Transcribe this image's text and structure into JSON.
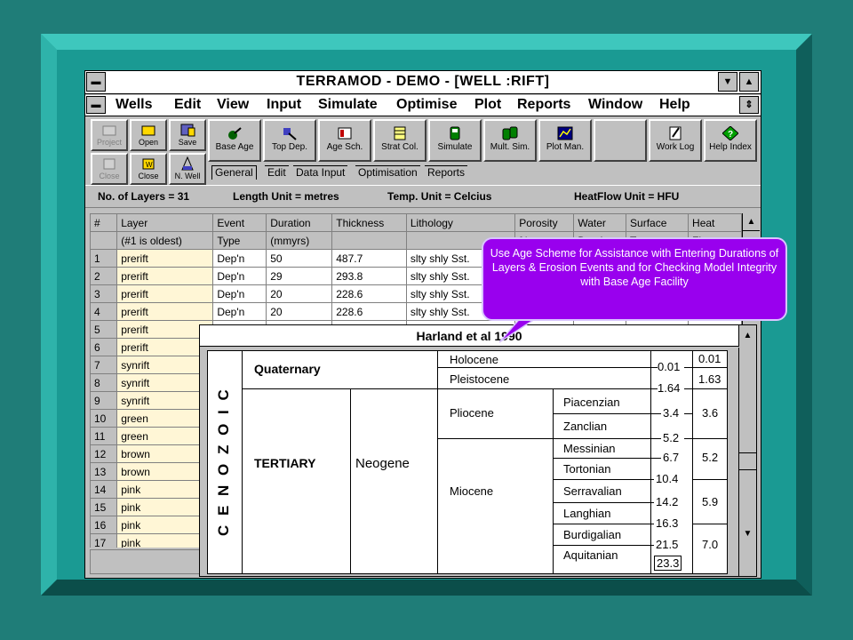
{
  "window": {
    "title": "TERRAMOD - DEMO - [WELL :RIFT]",
    "sys_menu": "▬",
    "scroll_down": "▼",
    "scroll_up": "▲",
    "doc_menu": "▬",
    "restore": "⇕"
  },
  "menu": [
    "Wells",
    "Edit",
    "View",
    "Input",
    "Simulate",
    "Optimise",
    "Plot",
    "Reports",
    "Window",
    "Help"
  ],
  "toolbar": {
    "project": "Project",
    "open": "Open",
    "save": "Save",
    "close_disabled": "Close",
    "close": "Close",
    "new_well": "N. Well",
    "buttons": [
      "Base Age",
      "Top Dep.",
      "Age Sch.",
      "Strat Col.",
      "Simulate",
      "Mult. Sim.",
      "Plot Man.",
      "Work Log",
      "Help Index"
    ]
  },
  "tabs": [
    "General",
    "Edit",
    "Data Input",
    "Optimisation",
    "Reports"
  ],
  "info": {
    "layers": "No. of Layers  = 31",
    "length": "Length Unit  = metres",
    "temp": "Temp. Unit  = Celcius",
    "heatflow": "HeatFlow Unit  = HFU"
  },
  "table": {
    "headers1": [
      "#",
      "Layer",
      "Event",
      "Duration",
      "Thickness",
      "Lithology",
      "Porosity",
      "Water",
      "Surface",
      "Heat"
    ],
    "headers2": [
      "",
      "(#1 is oldest)",
      "Type",
      "(mmyrs)",
      "",
      "",
      "%",
      "Depth",
      "Temp",
      "Flow"
    ],
    "rows": [
      {
        "n": "1",
        "layer": "prerift",
        "event": "Dep'n",
        "duration": "50",
        "thickness": "487.7",
        "lith": "slty shly Sst."
      },
      {
        "n": "2",
        "layer": "prerift",
        "event": "Dep'n",
        "duration": "29",
        "thickness": "293.8",
        "lith": "slty shly Sst."
      },
      {
        "n": "3",
        "layer": "prerift",
        "event": "Dep'n",
        "duration": "20",
        "thickness": "228.6",
        "lith": "slty shly Sst."
      },
      {
        "n": "4",
        "layer": "prerift",
        "event": "Dep'n",
        "duration": "20",
        "thickness": "228.6",
        "lith": "slty shly Sst."
      },
      {
        "n": "5",
        "layer": "prerift"
      },
      {
        "n": "6",
        "layer": "prerift"
      },
      {
        "n": "7",
        "layer": "synrift"
      },
      {
        "n": "8",
        "layer": "synrift"
      },
      {
        "n": "9",
        "layer": "synrift"
      },
      {
        "n": "10",
        "layer": "green"
      },
      {
        "n": "11",
        "layer": "green"
      },
      {
        "n": "12",
        "layer": "brown"
      },
      {
        "n": "13",
        "layer": "brown"
      },
      {
        "n": "14",
        "layer": "pink"
      },
      {
        "n": "15",
        "layer": "pink"
      },
      {
        "n": "16",
        "layer": "pink"
      },
      {
        "n": "17",
        "layer": "pink"
      }
    ]
  },
  "age_scheme": {
    "title": "Harland et al 1990",
    "era": "C E N O Z O I C",
    "quaternary": "Quaternary",
    "tertiary": "TERTIARY",
    "neogene": "Neogene",
    "epochs": {
      "holocene": "Holocene",
      "pleistocene": "Pleistocene",
      "pliocene": "Pliocene",
      "miocene": "Miocene"
    },
    "stages": [
      "Piacenzian",
      "Zanclian",
      "Messinian",
      "Tortonian",
      "Serravalian",
      "Langhian",
      "Burdigalian",
      "Aquitanian"
    ],
    "boundaries": [
      "0.01",
      "1.64",
      "3.4",
      "5.2",
      "6.7",
      "10.4",
      "14.2",
      "16.3",
      "21.5",
      "23.3"
    ],
    "durations": [
      "0.01",
      "1.63",
      "3.6",
      "5.2",
      "5.9",
      "7.0"
    ]
  },
  "callout": {
    "text": "Use Age Scheme for Assistance with Entering Durations of Layers & Erosion Events and for Checking Model Integrity with Base Age Facility"
  },
  "colors": {
    "callout": "#9900ee",
    "background": "#1f7d78",
    "layer_cell": "#fff6d6"
  }
}
